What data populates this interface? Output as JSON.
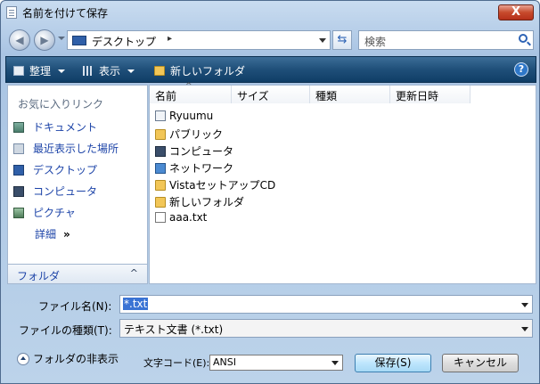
{
  "window": {
    "title": "名前を付けて保存",
    "close_label": "X"
  },
  "address": {
    "path": "デスクトップ",
    "arrow": "▸"
  },
  "search": {
    "placeholder": "検索"
  },
  "toolbar": {
    "organize": "整理",
    "view": "表示",
    "new_folder": "新しいフォルダ",
    "help": "?"
  },
  "favorites": {
    "title": "お気に入りリンク",
    "items": [
      {
        "label": "ドキュメント",
        "icon": "documents-icon"
      },
      {
        "label": "最近表示した場所",
        "icon": "recent-places-icon"
      },
      {
        "label": "デスクトップ",
        "icon": "desktop-icon"
      },
      {
        "label": "コンピュータ",
        "icon": "computer-icon"
      },
      {
        "label": "ピクチャ",
        "icon": "pictures-icon"
      }
    ],
    "more": "詳細",
    "more_chevron": "»",
    "folders_label": "フォルダ",
    "folders_chevron": "^"
  },
  "columns": {
    "name": "名前",
    "size": "サイズ",
    "type": "種類",
    "modified": "更新日時",
    "sort_mark": "^"
  },
  "files": [
    {
      "name": "Ryuumu",
      "icon": "user-folder-icon"
    },
    {
      "name": "パブリック",
      "icon": "folder-icon"
    },
    {
      "name": "コンピュータ",
      "icon": "computer-icon"
    },
    {
      "name": "ネットワーク",
      "icon": "network-icon"
    },
    {
      "name": "VistaセットアップCD",
      "icon": "folder-icon"
    },
    {
      "name": "新しいフォルダ",
      "icon": "folder-icon"
    },
    {
      "name": "aaa.txt",
      "icon": "text-file-icon"
    }
  ],
  "filename": {
    "label": "ファイル名(N):",
    "value": "*.txt"
  },
  "filetype": {
    "label": "ファイルの種類(T):",
    "value": "テキスト文書 (*.txt)"
  },
  "hide_folders": "フォルダの非表示",
  "encoding": {
    "label": "文字コード(E):",
    "value": "ANSI"
  },
  "buttons": {
    "save": "保存(S)",
    "cancel": "キャンセル"
  }
}
